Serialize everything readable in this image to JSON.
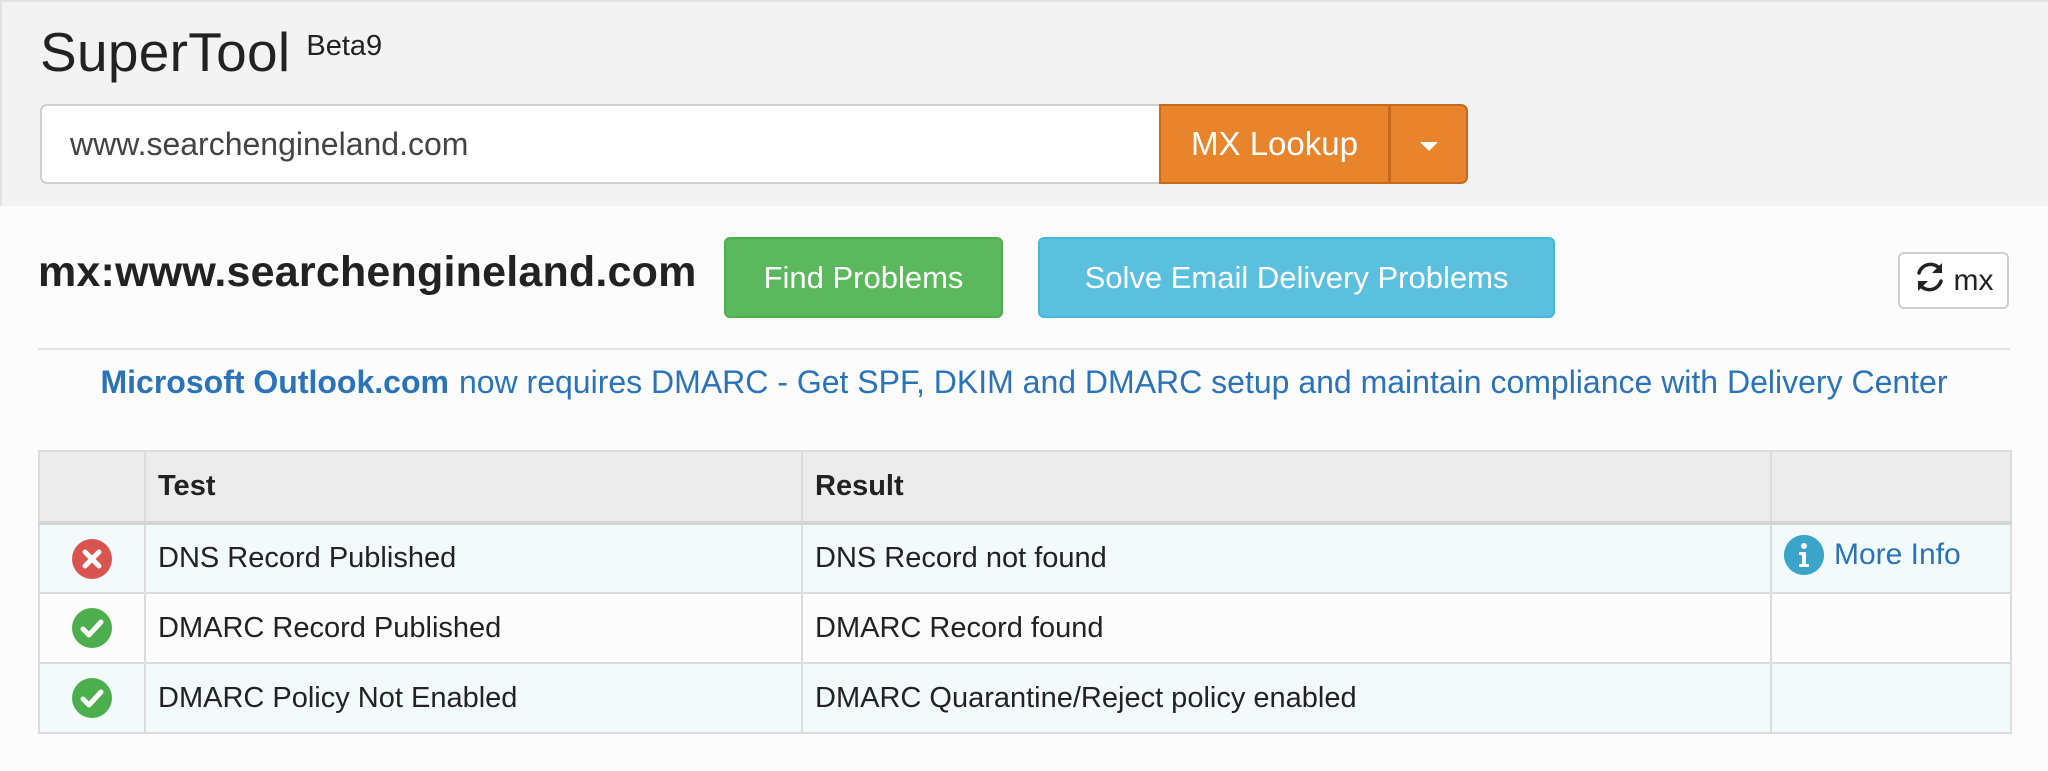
{
  "app": {
    "name": "SuperTool",
    "version": "Beta9"
  },
  "search": {
    "value": "www.searchengineland.com",
    "button_label": "MX Lookup"
  },
  "results": {
    "query_title": "mx:www.searchengineland.com",
    "find_button": "Find Problems",
    "solve_button": "Solve Email Delivery Problems",
    "refresh_label": "mx"
  },
  "promo": {
    "brand": "Microsoft Outlook.com",
    "text": "now requires DMARC - Get SPF, DKIM and DMARC setup and maintain compliance with Delivery Center"
  },
  "table": {
    "headers": [
      "",
      "Test",
      "Result",
      ""
    ],
    "rows": [
      {
        "status": "error",
        "test": "DNS Record Published",
        "result": "DNS Record not found",
        "more_info": "More Info"
      },
      {
        "status": "ok",
        "test": "DMARC Record Published",
        "result": "DMARC Record found",
        "more_info": ""
      },
      {
        "status": "ok",
        "test": "DMARC Policy Not Enabled",
        "result": "DMARC Quarantine/Reject policy enabled",
        "more_info": ""
      }
    ]
  },
  "colors": {
    "lookup_orange": "#e7842c",
    "success_green": "#5cb85c",
    "info_blue": "#5bc0de",
    "link_blue": "#2a73b8",
    "error_red": "#d9534f"
  },
  "icons": {
    "error": "x-circle-icon",
    "ok": "check-circle-icon",
    "info": "info-icon",
    "refresh": "refresh-icon",
    "dropdown": "caret-down-icon"
  }
}
